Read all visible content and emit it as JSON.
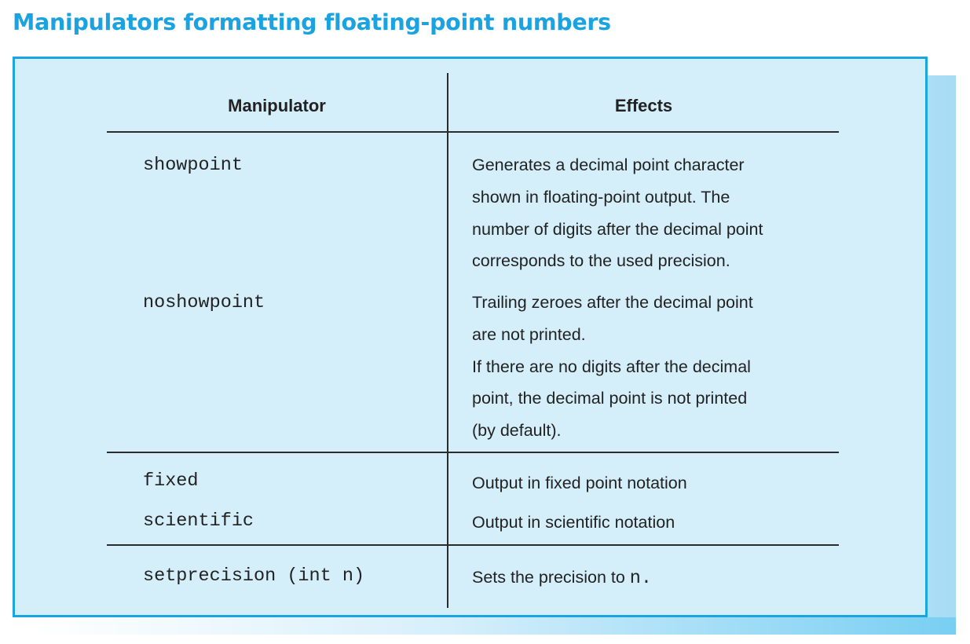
{
  "title": "Manipulators formatting floating-point numbers",
  "table": {
    "headers": {
      "manipulator": "Manipulator",
      "effects": "Effects"
    },
    "rows": [
      {
        "manipulator": "showpoint",
        "effects": [
          "Generates a decimal point character",
          "shown in floating-point output. The",
          "number of digits after the decimal point",
          "corresponds to the used precision."
        ]
      },
      {
        "manipulator": "noshowpoint",
        "effects": [
          "Trailing zeroes after the decimal point",
          "are not printed.",
          "If there are no digits after the decimal",
          "point, the  decimal point is not printed",
          "(by default)."
        ]
      },
      {
        "manipulator": "fixed",
        "effects": [
          "Output in fixed point notation"
        ]
      },
      {
        "manipulator": "scientific",
        "effects": [
          "Output in scientific notation"
        ]
      },
      {
        "manipulator": "setprecision (int n)",
        "effects_text": "Sets the precision to ",
        "effects_code": "n."
      }
    ]
  }
}
